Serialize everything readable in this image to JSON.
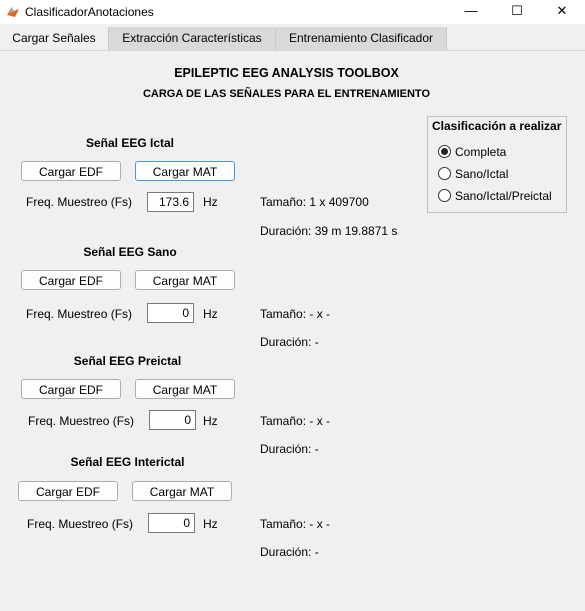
{
  "window": {
    "title": "ClasificadorAnotaciones",
    "minimize_glyph": "—",
    "maximize_glyph": "☐",
    "close_glyph": "✕"
  },
  "tabs": [
    {
      "label": "Cargar Señales",
      "active": true
    },
    {
      "label": "Extracción Características",
      "active": false
    },
    {
      "label": "Entrenamiento Clasificador",
      "active": false
    }
  ],
  "header": {
    "title": "EPILEPTIC EEG ANALYSIS TOOLBOX",
    "subtitle": "CARGA DE LAS SEÑALES PARA EL ENTRENAMIENTO"
  },
  "sections": [
    {
      "title": "Señal EEG Ictal",
      "load_edf": "Cargar EDF",
      "load_mat": "Cargar MAT",
      "fs_label": "Freq. Muestreo (Fs)",
      "fs_value": "173.6",
      "fs_unit": "Hz",
      "size_text": "Tamaño: 1 x 409700",
      "duration_text": "Duración: 39 m 19.8871 s"
    },
    {
      "title": "Señal EEG Sano",
      "load_edf": "Cargar EDF",
      "load_mat": "Cargar MAT",
      "fs_label": "Freq. Muestreo (Fs)",
      "fs_value": "0",
      "fs_unit": "Hz",
      "size_text": "Tamaño: - x -",
      "duration_text": "Duración: -"
    },
    {
      "title": "Señal EEG Preictal",
      "load_edf": "Cargar EDF",
      "load_mat": "Cargar MAT",
      "fs_label": "Freq. Muestreo (Fs)",
      "fs_value": "0",
      "fs_unit": "Hz",
      "size_text": "Tamaño: - x -",
      "duration_text": "Duración: -"
    },
    {
      "title": "Señal EEG Interictal",
      "load_edf": "Cargar EDF",
      "load_mat": "Cargar MAT",
      "fs_label": "Freq. Muestreo (Fs)",
      "fs_value": "0",
      "fs_unit": "Hz",
      "size_text": "Tamaño: - x -",
      "duration_text": "Duración: -"
    }
  ],
  "classification": {
    "title": "Clasificación a realizar",
    "options": [
      {
        "label": "Completa",
        "selected": true
      },
      {
        "label": "Sano/Ictal",
        "selected": false
      },
      {
        "label": "Sano/Ictal/Preictal",
        "selected": false
      }
    ]
  }
}
